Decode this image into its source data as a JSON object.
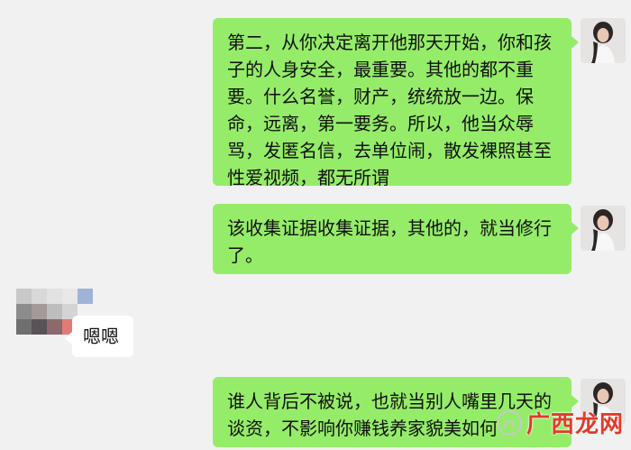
{
  "chat": {
    "messages": [
      {
        "side": "right",
        "text": "第二，从你决定离开他那天开始，你和孩子的人身安全，最重要。其他的都不重要。什么名誉，财产，统统放一边。保命，远离，第一要务。所以，他当众辱骂，发匿名信，去单位闹，散发裸照甚至性爱视频，都无所谓"
      },
      {
        "side": "right",
        "text": "该收集证据收集证据，其他的，就当修行了。"
      },
      {
        "side": "left",
        "text": "嗯嗯"
      },
      {
        "side": "right",
        "text": "谁人背后不被说，也就当别人嘴里几天的谈资，不影响你赚钱养家貌美如何"
      }
    ]
  },
  "watermark": {
    "text": "广西龙网",
    "icon": "watermark-logo-icon"
  },
  "colors": {
    "background": "#f1f1f1",
    "outgoing_bubble": "#95ec69",
    "incoming_bubble": "#ffffff",
    "watermark_red": "#e03b2b"
  }
}
